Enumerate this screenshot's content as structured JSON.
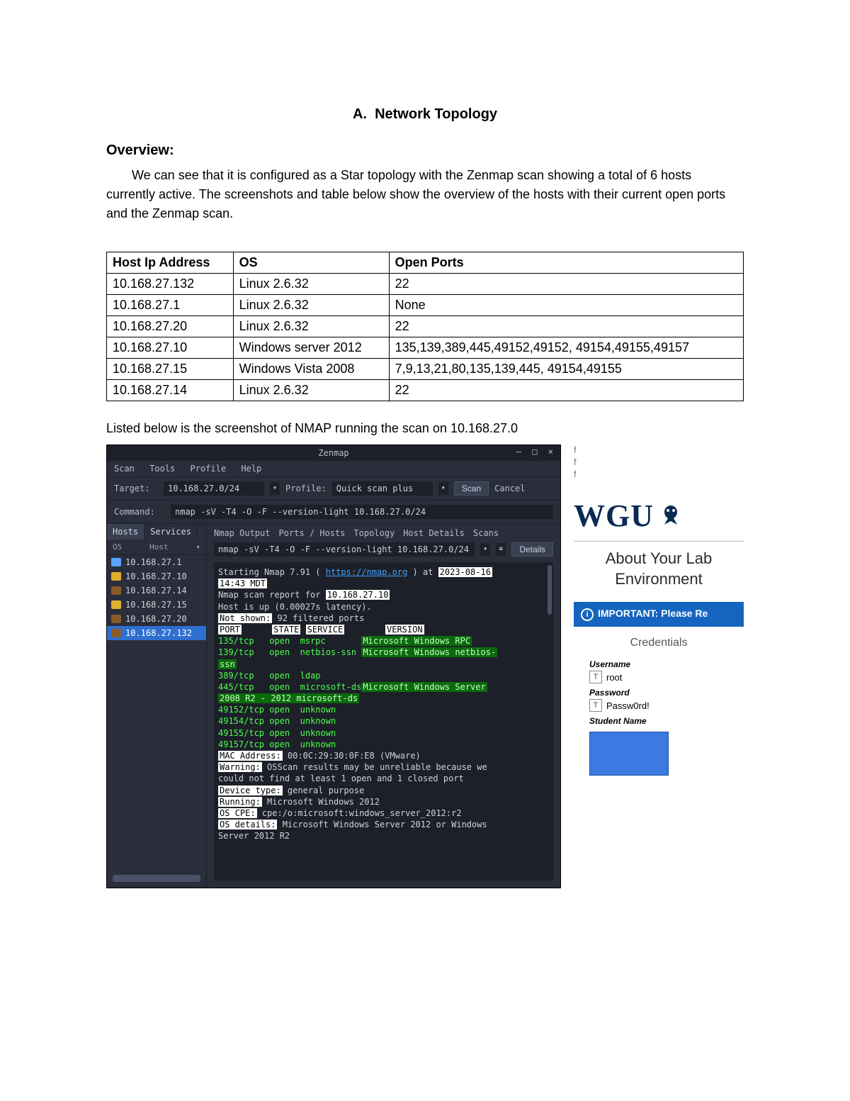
{
  "doc": {
    "section_letter": "A.",
    "section_title": "Network Topology",
    "overview_head": "Overview:",
    "overview_body": "We can see that it is configured as a Star topology with the Zenmap scan showing a total of 6 hosts currently active. The screenshots and table below show the overview of the hosts with their current open ports and the Zenmap scan.",
    "caption": "Listed below is the screenshot of NMAP running the scan on 10.168.27.0"
  },
  "table": {
    "headers": [
      "Host Ip Address",
      "OS",
      "Open Ports"
    ],
    "rows": [
      [
        "10.168.27.132",
        "Linux 2.6.32",
        "22"
      ],
      [
        "10.168.27.1",
        "Linux 2.6.32",
        "None"
      ],
      [
        "10.168.27.20",
        "Linux 2.6.32",
        "22"
      ],
      [
        "10.168.27.10",
        "Windows server 2012",
        "135,139,389,445,49152,49152, 49154,49155,49157"
      ],
      [
        "10.168.27.15",
        "Windows Vista 2008",
        "7,9,13,21,80,135,139,445, 49154,49155"
      ],
      [
        "10.168.27.14",
        "Linux 2.6.32",
        "22"
      ]
    ]
  },
  "zenmap": {
    "title": "Zenmap",
    "win_buttons": "–  □  ×",
    "menu": [
      "Scan",
      "Tools",
      "Profile",
      "Help"
    ],
    "target_label": "Target:",
    "target_value": "10.168.27.0/24",
    "profile_label": "Profile:",
    "profile_value": "Quick scan plus",
    "scan_btn": "Scan",
    "cancel_btn": "Cancel",
    "command_label": "Command:",
    "command_value": "nmap -sV -T4 -O -F --version-light 10.168.27.0/24",
    "left_tabs": {
      "hosts": "Hosts",
      "services": "Services"
    },
    "hosts_header": {
      "os": "OS",
      "host": "Host",
      "arrow": "▾"
    },
    "hosts": [
      {
        "ip": "10.168.27.1",
        "icon_color": "#5aa3ff"
      },
      {
        "ip": "10.168.27.10",
        "icon_color": "#e0b030"
      },
      {
        "ip": "10.168.27.14",
        "icon_color": "#8a5a2a"
      },
      {
        "ip": "10.168.27.15",
        "icon_color": "#e0b030"
      },
      {
        "ip": "10.168.27.20",
        "icon_color": "#8a5a2a"
      },
      {
        "ip": "10.168.27.132",
        "icon_color": "#8a5a2a",
        "selected": true
      }
    ],
    "right_tabs": [
      "Nmap Output",
      "Ports / Hosts",
      "Topology",
      "Host Details",
      "Scans"
    ],
    "filter_value": "nmap -sV -T4 -O -F --version-light 10.168.27.0/24",
    "details_btn": "Details",
    "output": {
      "l1a": "Starting Nmap 7.91 ( ",
      "l1link": "https://nmap.org",
      "l1b": " ) at ",
      "l1date": "2023-08-16",
      "l2": "14:43 MDT",
      "l3a": "Nmap scan report for ",
      "l3ip": "10.168.27.10",
      "l4": "Host is up (0.00027s latency).",
      "l5a": "Not shown:",
      "l5b": " 92 filtered ports",
      "hdr": {
        "port": "PORT",
        "state": "STATE",
        "service": "SERVICE",
        "version": "VERSION"
      },
      "ports": [
        {
          "p": "135/tcp",
          "st": "open",
          "sv": "msrpc",
          "ver": "Microsoft Windows RPC"
        },
        {
          "p": "139/tcp",
          "st": "open",
          "sv": "netbios-ssn",
          "ver": "Microsoft Windows netbios-"
        }
      ],
      "ssn": "ssn",
      "ports2": [
        {
          "p": "389/tcp",
          "st": "open",
          "sv": "ldap",
          "ver": ""
        },
        {
          "p": "445/tcp",
          "st": "open",
          "sv": "microsoft-ds",
          "ver": "Microsoft Windows Server"
        }
      ],
      "l6": "2008 R2 - 2012 microsoft-ds",
      "ports3": [
        {
          "p": "49152/tcp",
          "st": "open",
          "sv": "unknown"
        },
        {
          "p": "49154/tcp",
          "st": "open",
          "sv": "unknown"
        },
        {
          "p": "49155/tcp",
          "st": "open",
          "sv": "unknown"
        },
        {
          "p": "49157/tcp",
          "st": "open",
          "sv": "unknown"
        }
      ],
      "mac_a": "MAC Address:",
      "mac_b": " 00:0C:29:30:0F:E8 (VMware)",
      "warn_a": "Warning:",
      "warn_b": " OSScan results may be unreliable because we",
      "warn_c": "could not find at least 1 open and 1 closed port",
      "dev_a": "Device type:",
      "dev_b": " general purpose",
      "run_a": "Running:",
      "run_b": " Microsoft Windows 2012",
      "cpe_a": "OS CPE:",
      "cpe_b": " cpe:/o:microsoft:windows_server_2012:r2",
      "osd_a": "OS details:",
      "osd_b": " Microsoft Windows Server 2012 or Windows",
      "osd_c": "Server 2012 R2"
    }
  },
  "side": {
    "f_letters": [
      "f",
      "f",
      "f"
    ],
    "wgu": "WGU",
    "about": "About Your Lab Environment",
    "important": "IMPORTANT: Please Re",
    "credentials_title": "Credentials",
    "username_label": "Username",
    "username_value": "root",
    "password_label": "Password",
    "password_value": "Passw0rd!",
    "student_label": "Student Name"
  }
}
